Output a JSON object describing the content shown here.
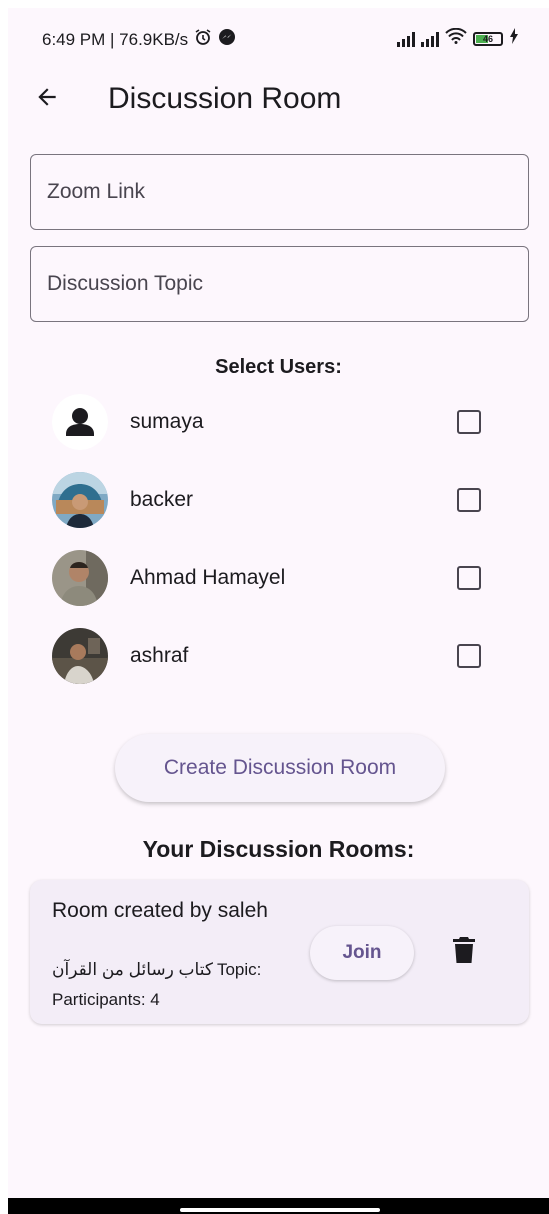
{
  "status_bar": {
    "left_text": "6:49 PM | 76.9KB/s",
    "battery_level": "46"
  },
  "app_bar": {
    "title": "Discussion Room"
  },
  "form": {
    "zoom_link_placeholder": "Zoom Link",
    "topic_placeholder": "Discussion Topic"
  },
  "select_users_label": "Select Users:",
  "users": [
    {
      "name": "sumaya",
      "checked": false,
      "avatar": "default-person"
    },
    {
      "name": "backer",
      "checked": false,
      "avatar": "photo"
    },
    {
      "name": "Ahmad Hamayel",
      "checked": false,
      "avatar": "photo"
    },
    {
      "name": "ashraf",
      "checked": false,
      "avatar": "photo"
    }
  ],
  "create_button_label": "Create Discussion Room",
  "your_rooms_label": "Your Discussion Rooms:",
  "rooms": [
    {
      "title": "Room created by saleh",
      "topic_label": "Topic:",
      "topic_value": "كتاب رسائل من القرآن",
      "participants": "Participants: 4",
      "join_label": "Join"
    }
  ],
  "colors": {
    "background": "#fdf7fd",
    "accent": "#65558f",
    "card": "#f3edf7"
  }
}
